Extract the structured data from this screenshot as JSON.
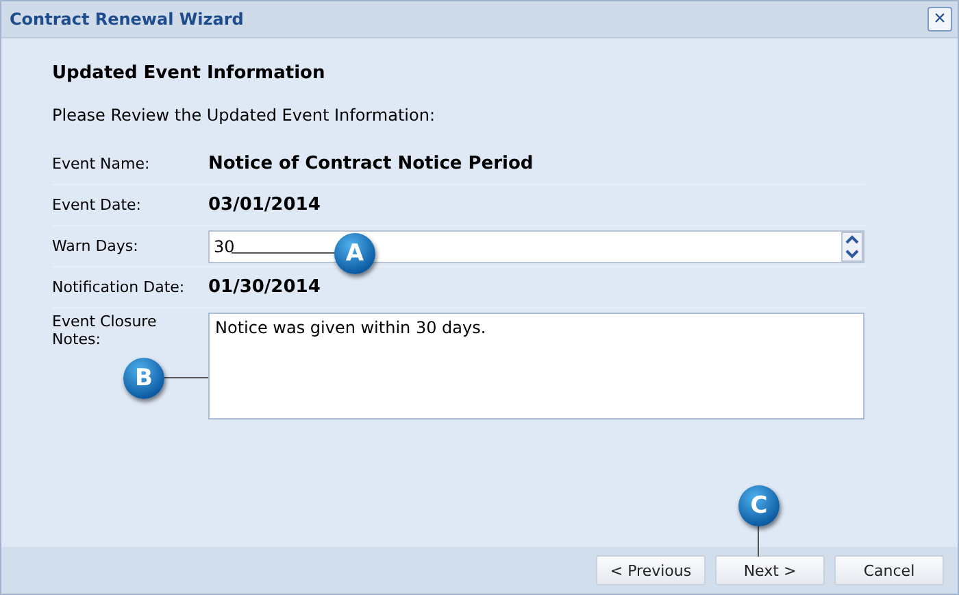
{
  "window": {
    "title": "Contract Renewal Wizard",
    "close": "×"
  },
  "heading": "Updated Event Information",
  "instructions": "Please Review the Updated Event Information:",
  "fields": [
    {
      "kind": "text",
      "label": "Event Name:",
      "value": "Notice of Contract Notice Period"
    },
    {
      "kind": "text",
      "label": "Event Date:",
      "value": "03/01/2014"
    },
    {
      "kind": "spinner",
      "label": "Warn Days:",
      "value": "30"
    },
    {
      "kind": "text",
      "label": "Notification Date:",
      "value": "01/30/2014"
    },
    {
      "kind": "textarea",
      "label": "Event Closure Notes:",
      "value": "Notice was given within 30 days."
    }
  ],
  "buttons": [
    "< Previous",
    "Next >",
    "Cancel"
  ],
  "callouts": [
    "A",
    "B",
    "C"
  ]
}
